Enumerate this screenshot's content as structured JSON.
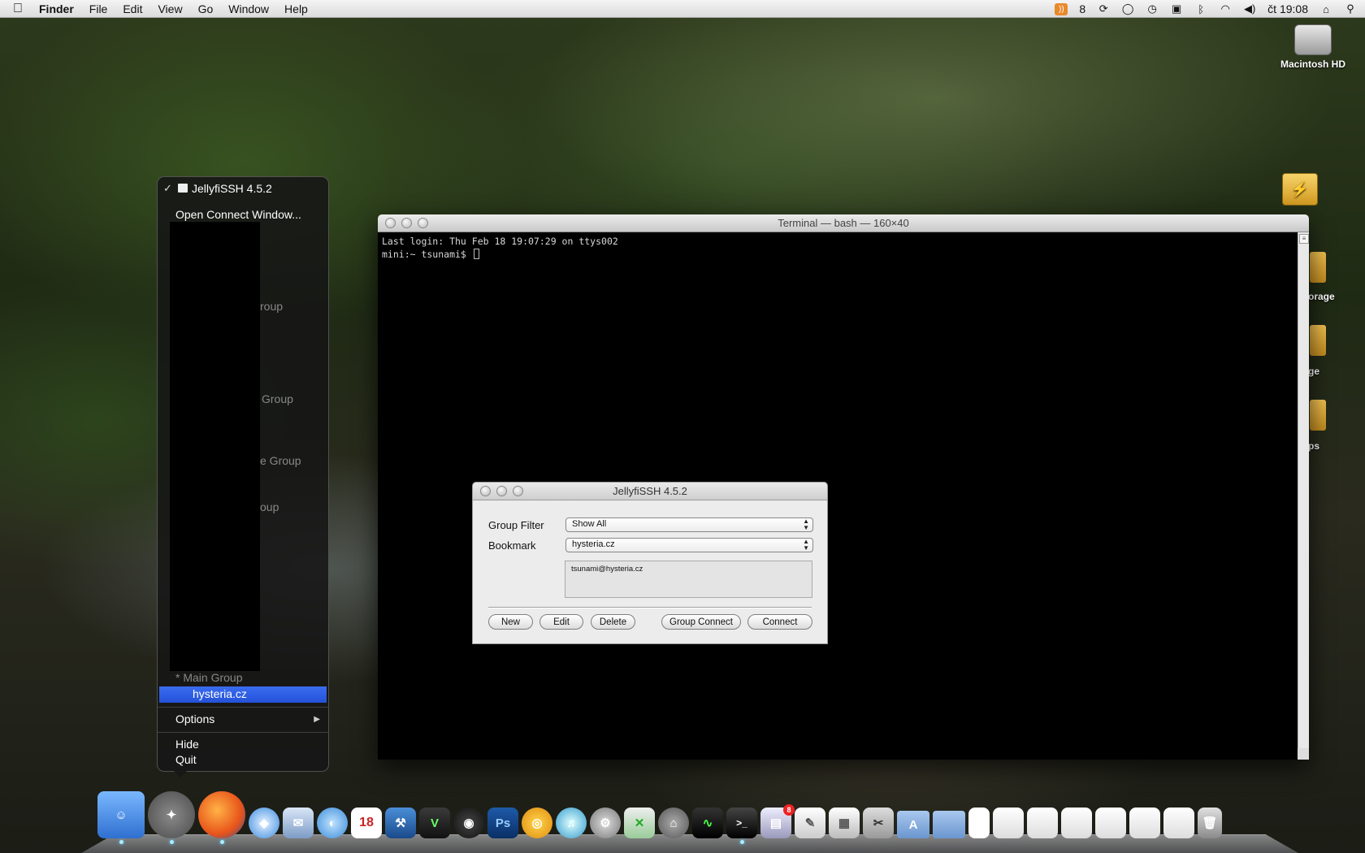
{
  "menubar": {
    "app": "Finder",
    "items": [
      "File",
      "Edit",
      "View",
      "Go",
      "Window",
      "Help"
    ],
    "status": {
      "rss_count": "8",
      "clock": "čt 19:08"
    }
  },
  "desktop": {
    "icons": [
      {
        "label": "Macintosh HD"
      },
      {
        "label": ""
      }
    ],
    "partial_labels": [
      "orage",
      "ge",
      "ps"
    ]
  },
  "terminal": {
    "title": "Terminal — bash — 160×40",
    "lines": [
      "Last login: Thu Feb 18 19:07:29 on ttys002",
      "mini:~ tsunami$ "
    ]
  },
  "jelly": {
    "title": "JellyfiSSH 4.5.2",
    "group_filter_label": "Group Filter",
    "group_filter_value": "Show All",
    "bookmark_label": "Bookmark",
    "bookmark_value": "hysteria.cz",
    "info": "tsunami@hysteria.cz",
    "buttons": {
      "new": "New",
      "edit": "Edit",
      "delete": "Delete",
      "group_connect": "Group Connect",
      "connect": "Connect"
    }
  },
  "dockmenu": {
    "app_title": "JellyfiSSH 4.5.2",
    "open_connect": "Open Connect Window...",
    "hidden_groups": [
      "roup",
      "Group",
      "e Group",
      "oup"
    ],
    "main_group": "* Main Group",
    "selected_bookmark": "hysteria.cz",
    "options": "Options",
    "hide": "Hide",
    "quit": "Quit"
  },
  "dock": {
    "calendar_day": "18",
    "badge_count": "8"
  },
  "colors": {
    "menu_highlight": "#2f5fe6",
    "terminal_bg": "#000000",
    "window_bg": "#ececec"
  }
}
